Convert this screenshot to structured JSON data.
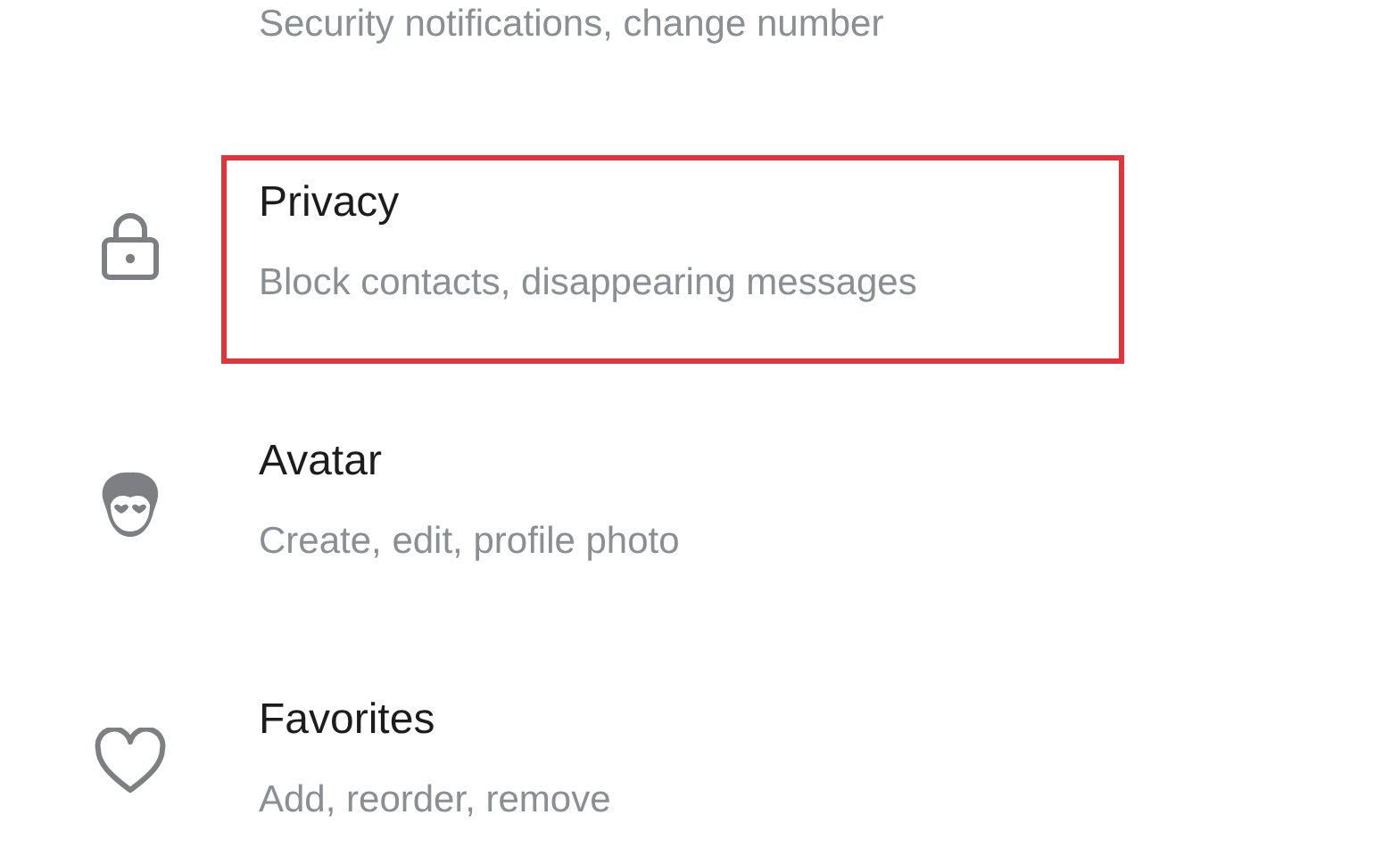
{
  "settings_items": [
    {
      "kind": "plain",
      "subtitle": "Security notifications, change number",
      "highlighted": false
    },
    {
      "kind": "lock",
      "title": "Privacy",
      "subtitle": "Block contacts, disappearing messages",
      "highlighted": true
    },
    {
      "kind": "avatar",
      "title": "Avatar",
      "subtitle": "Create, edit, profile photo",
      "highlighted": false
    },
    {
      "kind": "heart",
      "title": "Favorites",
      "subtitle": "Add, reorder, remove",
      "highlighted": false
    }
  ]
}
